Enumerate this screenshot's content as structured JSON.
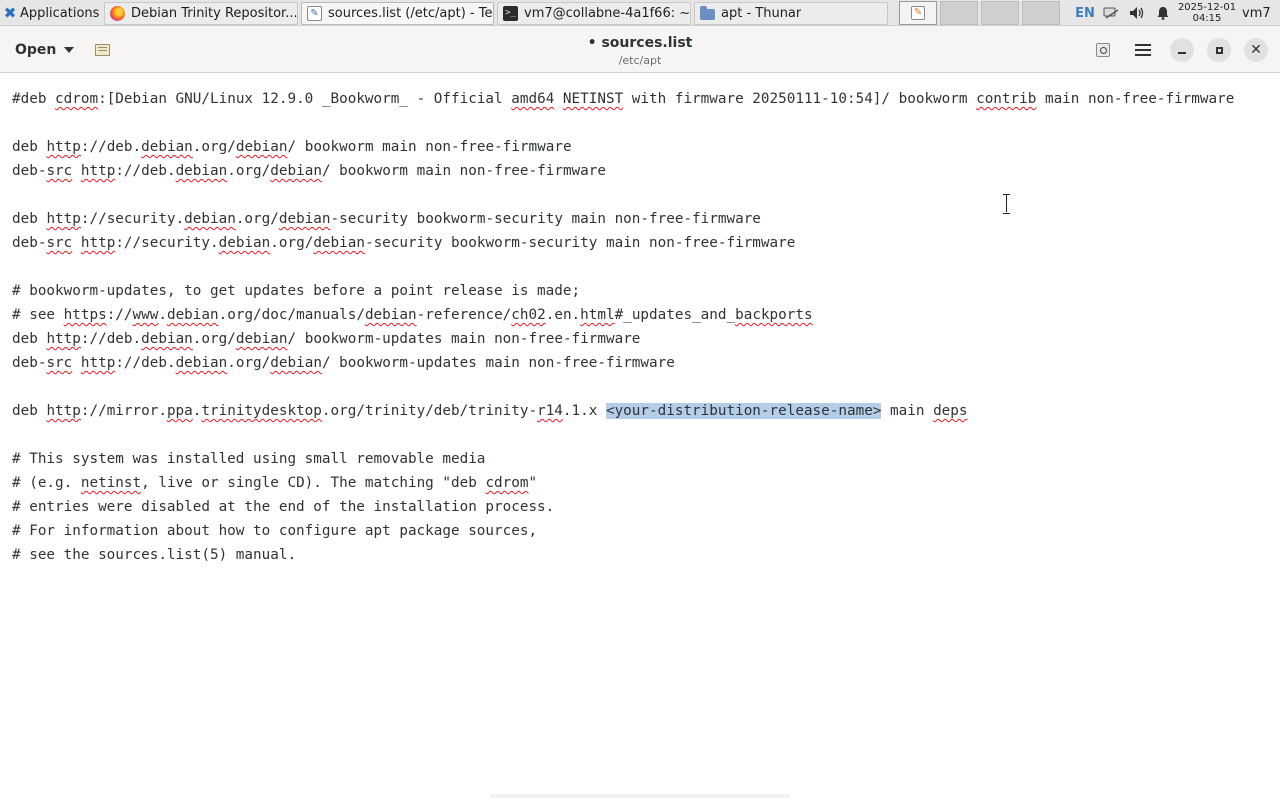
{
  "panel": {
    "apps_menu_label": "Applications",
    "tasks": [
      {
        "label": "Debian Trinity Repositor...",
        "icon": "firefox-icon"
      },
      {
        "label": "sources.list (/etc/apt) - Te...",
        "icon": "text-editor-icon"
      },
      {
        "label": "vm7@collabne-4a1f66: ~",
        "icon": "terminal-icon"
      },
      {
        "label": "apt - Thunar",
        "icon": "folder-icon"
      }
    ],
    "keyboard_layout": "EN",
    "clock": {
      "date": "2025-12-01",
      "time": "04:15"
    },
    "user": "vm7"
  },
  "headerbar": {
    "open_label": "Open",
    "title": "• sources.list",
    "subtitle": "/etc/apt"
  },
  "editor": {
    "lines": [
      [
        {
          "t": "#deb "
        },
        {
          "t": "cdrom",
          "sp": true
        },
        {
          "t": ":[Debian GNU/Linux 12.9.0 _Bookworm_ - Official "
        },
        {
          "t": "amd64",
          "sp": true
        },
        {
          "t": " "
        },
        {
          "t": "NETINST",
          "sp": true
        },
        {
          "t": " with firmware 20250111-10:54]/ bookworm "
        },
        {
          "t": "contrib",
          "sp": true
        },
        {
          "t": " main non-free-firmware"
        }
      ],
      [],
      [
        {
          "t": "deb "
        },
        {
          "t": "http",
          "sp": true
        },
        {
          "t": "://deb."
        },
        {
          "t": "debian",
          "sp": true
        },
        {
          "t": ".org/"
        },
        {
          "t": "debian",
          "sp": true
        },
        {
          "t": "/ bookworm main non-free-firmware"
        }
      ],
      [
        {
          "t": "deb-"
        },
        {
          "t": "src",
          "sp": true
        },
        {
          "t": " "
        },
        {
          "t": "http",
          "sp": true
        },
        {
          "t": "://deb."
        },
        {
          "t": "debian",
          "sp": true
        },
        {
          "t": ".org/"
        },
        {
          "t": "debian",
          "sp": true
        },
        {
          "t": "/ bookworm main non-free-firmware"
        }
      ],
      [],
      [
        {
          "t": "deb "
        },
        {
          "t": "http",
          "sp": true
        },
        {
          "t": "://security."
        },
        {
          "t": "debian",
          "sp": true
        },
        {
          "t": ".org/"
        },
        {
          "t": "debian",
          "sp": true
        },
        {
          "t": "-security bookworm-security main non-free-firmware"
        }
      ],
      [
        {
          "t": "deb-"
        },
        {
          "t": "src",
          "sp": true
        },
        {
          "t": " "
        },
        {
          "t": "http",
          "sp": true
        },
        {
          "t": "://security."
        },
        {
          "t": "debian",
          "sp": true
        },
        {
          "t": ".org/"
        },
        {
          "t": "debian",
          "sp": true
        },
        {
          "t": "-security bookworm-security main non-free-firmware"
        }
      ],
      [],
      [
        {
          "t": "# bookworm-updates, to get updates before a point release is made;"
        }
      ],
      [
        {
          "t": "# see "
        },
        {
          "t": "https",
          "sp": true
        },
        {
          "t": "://"
        },
        {
          "t": "www",
          "sp": true
        },
        {
          "t": "."
        },
        {
          "t": "debian",
          "sp": true
        },
        {
          "t": ".org/doc/manuals/"
        },
        {
          "t": "debian",
          "sp": true
        },
        {
          "t": "-reference/"
        },
        {
          "t": "ch02",
          "sp": true
        },
        {
          "t": ".en."
        },
        {
          "t": "html",
          "sp": true
        },
        {
          "t": "#_updates_and_"
        },
        {
          "t": "backports",
          "sp": true
        }
      ],
      [
        {
          "t": "deb "
        },
        {
          "t": "http",
          "sp": true
        },
        {
          "t": "://deb."
        },
        {
          "t": "debian",
          "sp": true
        },
        {
          "t": ".org/"
        },
        {
          "t": "debian",
          "sp": true
        },
        {
          "t": "/ bookworm-updates main non-free-firmware"
        }
      ],
      [
        {
          "t": "deb-"
        },
        {
          "t": "src",
          "sp": true
        },
        {
          "t": " "
        },
        {
          "t": "http",
          "sp": true
        },
        {
          "t": "://deb."
        },
        {
          "t": "debian",
          "sp": true
        },
        {
          "t": ".org/"
        },
        {
          "t": "debian",
          "sp": true
        },
        {
          "t": "/ bookworm-updates main non-free-firmware"
        }
      ],
      [],
      [
        {
          "t": "deb "
        },
        {
          "t": "http",
          "sp": true
        },
        {
          "t": "://mirror."
        },
        {
          "t": "ppa",
          "sp": true
        },
        {
          "t": "."
        },
        {
          "t": "trinitydesktop",
          "sp": true
        },
        {
          "t": ".org/trinity/deb/trinity-"
        },
        {
          "t": "r14",
          "sp": true
        },
        {
          "t": ".1.x "
        },
        {
          "t": "<your-distribution-release-name>",
          "sel": true
        },
        {
          "t": " main "
        },
        {
          "t": "deps",
          "sp": true
        }
      ],
      [],
      [
        {
          "t": "# This system was installed using small removable media"
        }
      ],
      [
        {
          "t": "# (e.g. "
        },
        {
          "t": "netinst",
          "sp": true
        },
        {
          "t": ", live or single CD). The matching \"deb "
        },
        {
          "t": "cdrom",
          "sp": true
        },
        {
          "t": "\""
        }
      ],
      [
        {
          "t": "# entries were disabled at the end of the installation process."
        }
      ],
      [
        {
          "t": "# For information about how to configure apt package sources,"
        }
      ],
      [
        {
          "t": "# see the sources.list(5) manual."
        }
      ]
    ]
  }
}
